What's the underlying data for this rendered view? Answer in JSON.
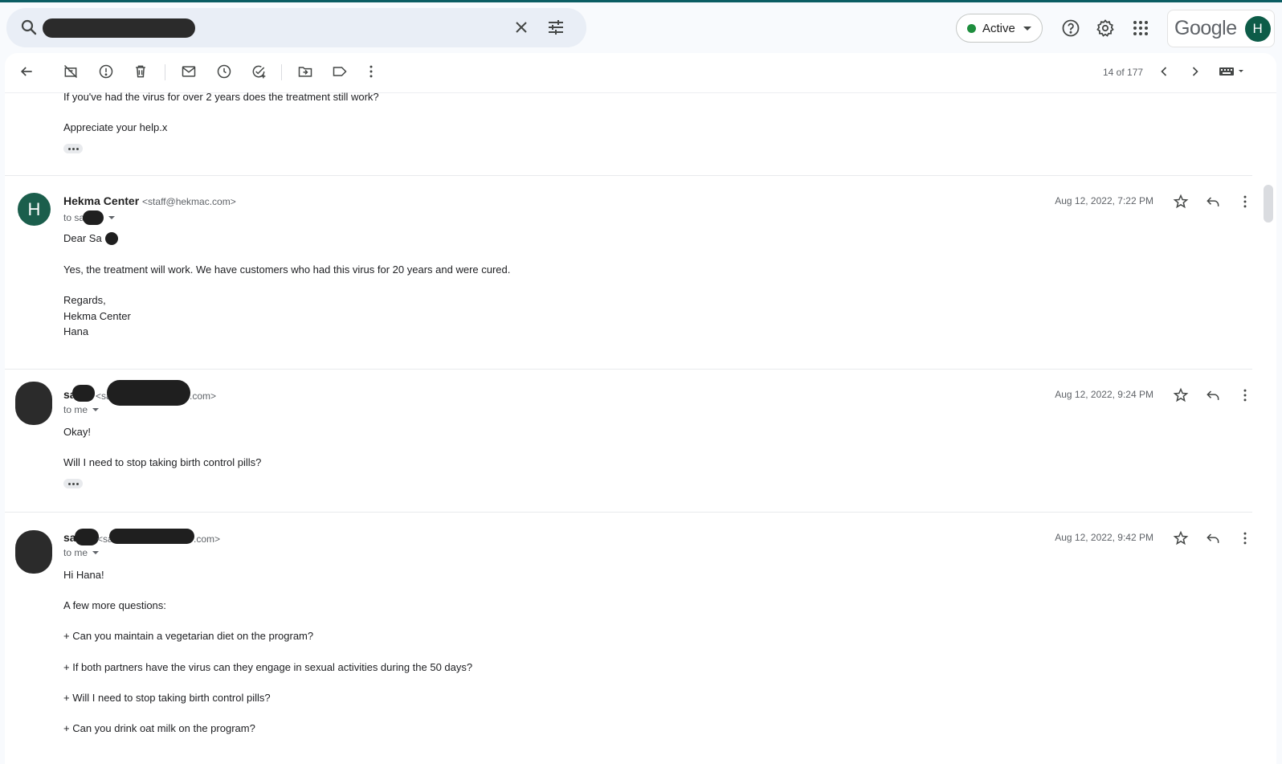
{
  "search": {
    "query_redacted": true,
    "icons": {
      "search": "search-icon",
      "clear": "close-icon",
      "options": "tune-icon"
    }
  },
  "header": {
    "status_label": "Active",
    "status_color": "#1e8e3e",
    "icons": [
      "help-icon",
      "gear-icon",
      "apps-grid-icon"
    ],
    "brand": "Google",
    "account_initial": "H",
    "account_color": "#0d5c48"
  },
  "toolbar": {
    "icons": [
      "back-arrow-icon",
      "archive-icon",
      "report-spam-icon",
      "delete-icon",
      "mark-unread-icon",
      "snooze-icon",
      "add-task-icon",
      "move-to-icon",
      "label-icon",
      "more-vert-icon"
    ],
    "counter": "14 of 177",
    "input_tool_icon": "keyboard-icon"
  },
  "messages": [
    {
      "collapsed_top": true,
      "body": [
        "If you've had the virus for over 2 years does the treatment still work?",
        "Appreciate your help.x"
      ]
    },
    {
      "avatar_initial": "H",
      "sender_name": "Hekma Center",
      "sender_email": "<staff@hekmac.com>",
      "to": "to sa",
      "date": "Aug 12, 2022, 7:22 PM",
      "greeting": "Dear Sa",
      "body": [
        "Yes, the treatment will work. We have customers who had this virus for 20 years and were cured."
      ],
      "signature": [
        "Regards,",
        "Hekma Center",
        "Hana"
      ]
    },
    {
      "sender_name": "sa",
      "sender_email_prefix": "<sa",
      "sender_email_suffix": ".com>",
      "to": "to me",
      "date": "Aug 12, 2022, 9:24 PM",
      "body": [
        "Okay!",
        "Will I need to stop taking birth control pills?"
      ]
    },
    {
      "sender_name": "sa",
      "sender_email_prefix": "<sa",
      "sender_email_suffix": ".com>",
      "to": "to me",
      "date": "Aug 12, 2022, 9:42 PM",
      "body": [
        "Hi Hana!",
        "A few more questions:",
        "+ Can you maintain a vegetarian diet on the program?",
        "+ If both partners have the virus can they engage in sexual activities during the 50 days?",
        "+ Will I need to stop taking birth control pills?",
        "+ Can you drink oat milk on the program?"
      ]
    }
  ]
}
